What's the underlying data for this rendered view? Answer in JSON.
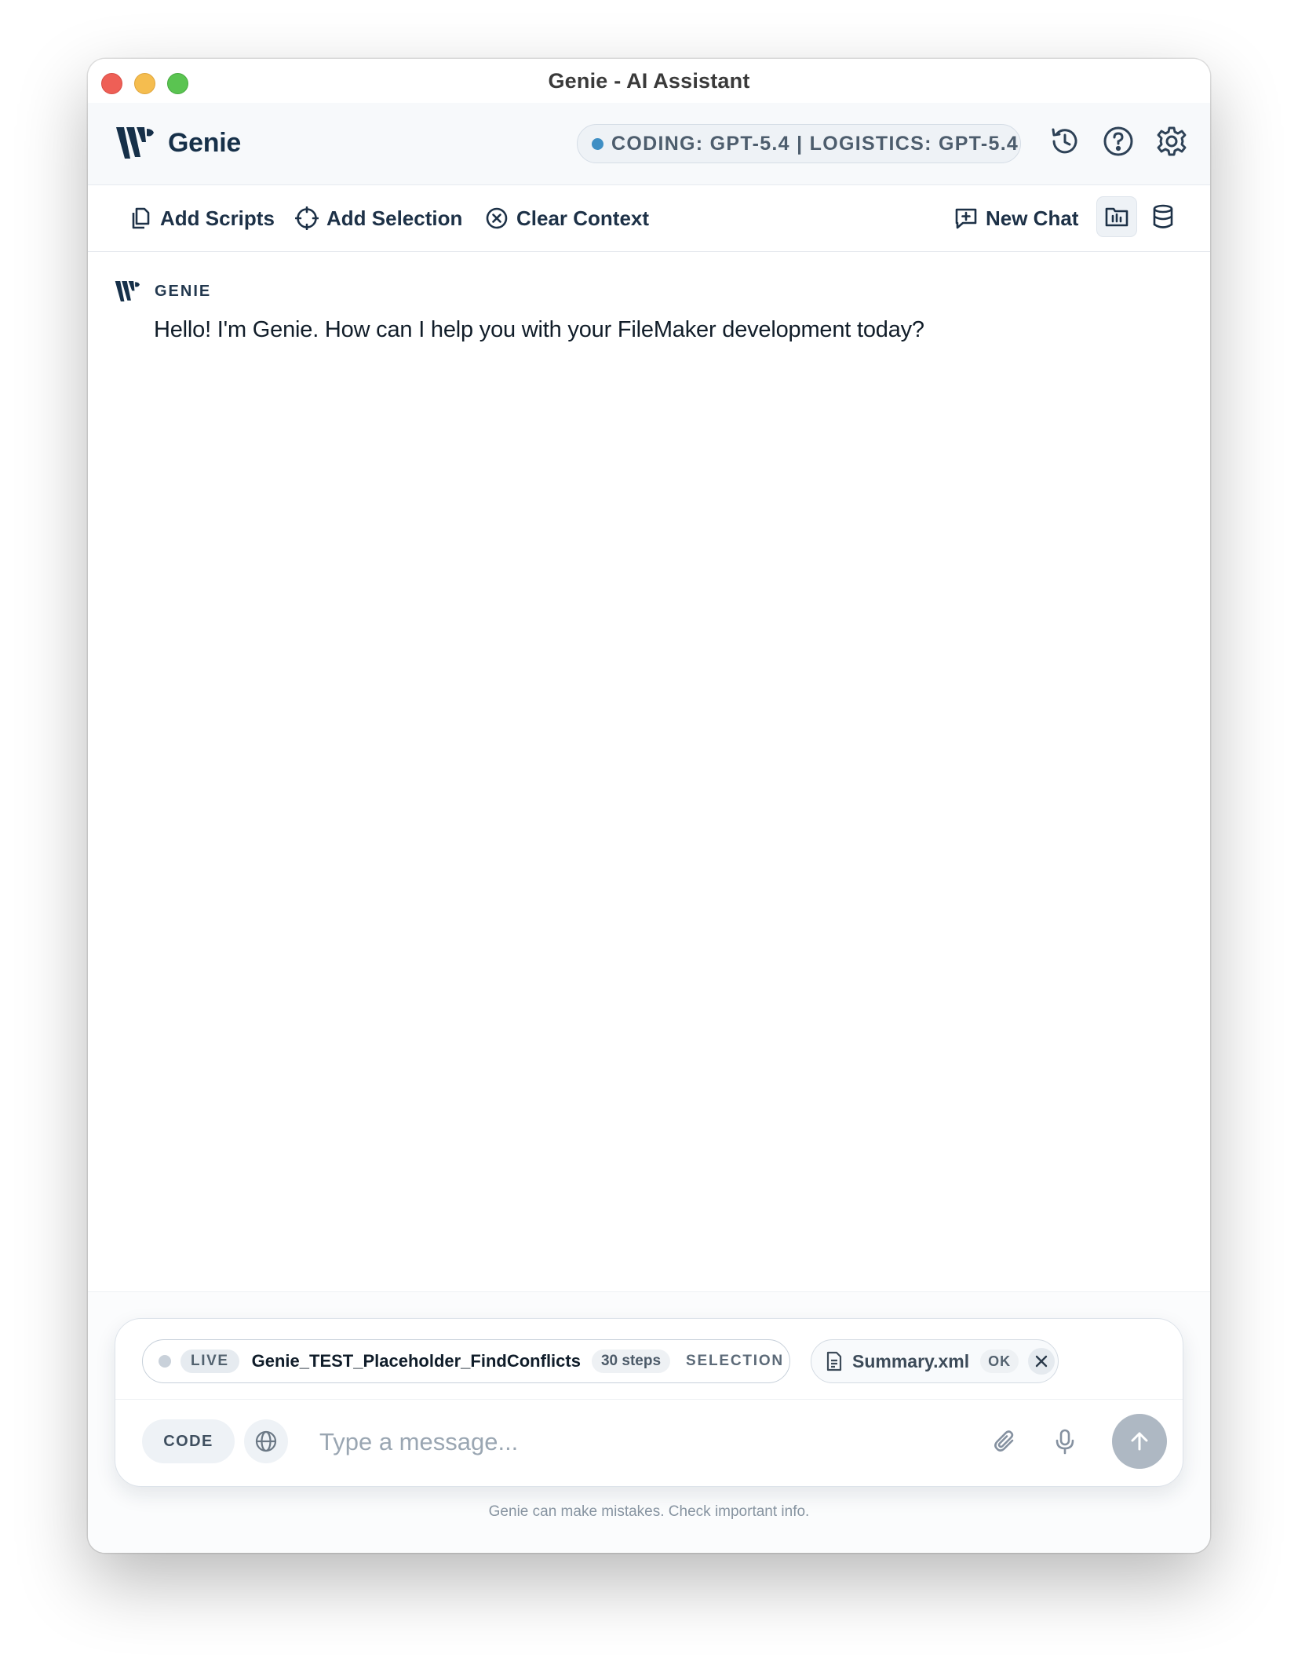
{
  "window": {
    "title": "Genie - AI Assistant"
  },
  "header": {
    "brand_name": "Genie",
    "model_status": "CODING: GPT-5.4 | LOGISTICS: GPT-5.4",
    "status_color": "#3f8fc4"
  },
  "toolbar": {
    "add_scripts_label": "Add Scripts",
    "add_selection_label": "Add Selection",
    "clear_context_label": "Clear Context",
    "new_chat_label": "New Chat"
  },
  "icons": {
    "history": "history-icon",
    "help": "help-icon",
    "settings": "gear-icon",
    "add_scripts": "copy-document-icon",
    "add_selection": "target-crosshair-icon",
    "clear_context": "circle-x-icon",
    "new_chat": "chat-plus-icon",
    "layout_panel": "folder-chart-icon",
    "database": "database-icon"
  },
  "conversation": {
    "messages": [
      {
        "sender": "GENIE",
        "text": "Hello! I'm Genie. How can I help you with your FileMaker development today?"
      }
    ]
  },
  "context": {
    "live_chip": {
      "badge": "LIVE",
      "script_name": "Genie_TEST_Placeholder_FindConflicts",
      "steps": "30 steps",
      "scope": "SELECTION"
    },
    "file_chip": {
      "file_name": "Summary.xml",
      "status": "OK"
    }
  },
  "composer": {
    "mode_label": "CODE",
    "placeholder": "Type a message..."
  },
  "footer": {
    "disclaimer": "Genie can make mistakes. Check important info."
  },
  "colors": {
    "brand_dark": "#163049",
    "send_button_disabled": "#aeb8c3"
  }
}
